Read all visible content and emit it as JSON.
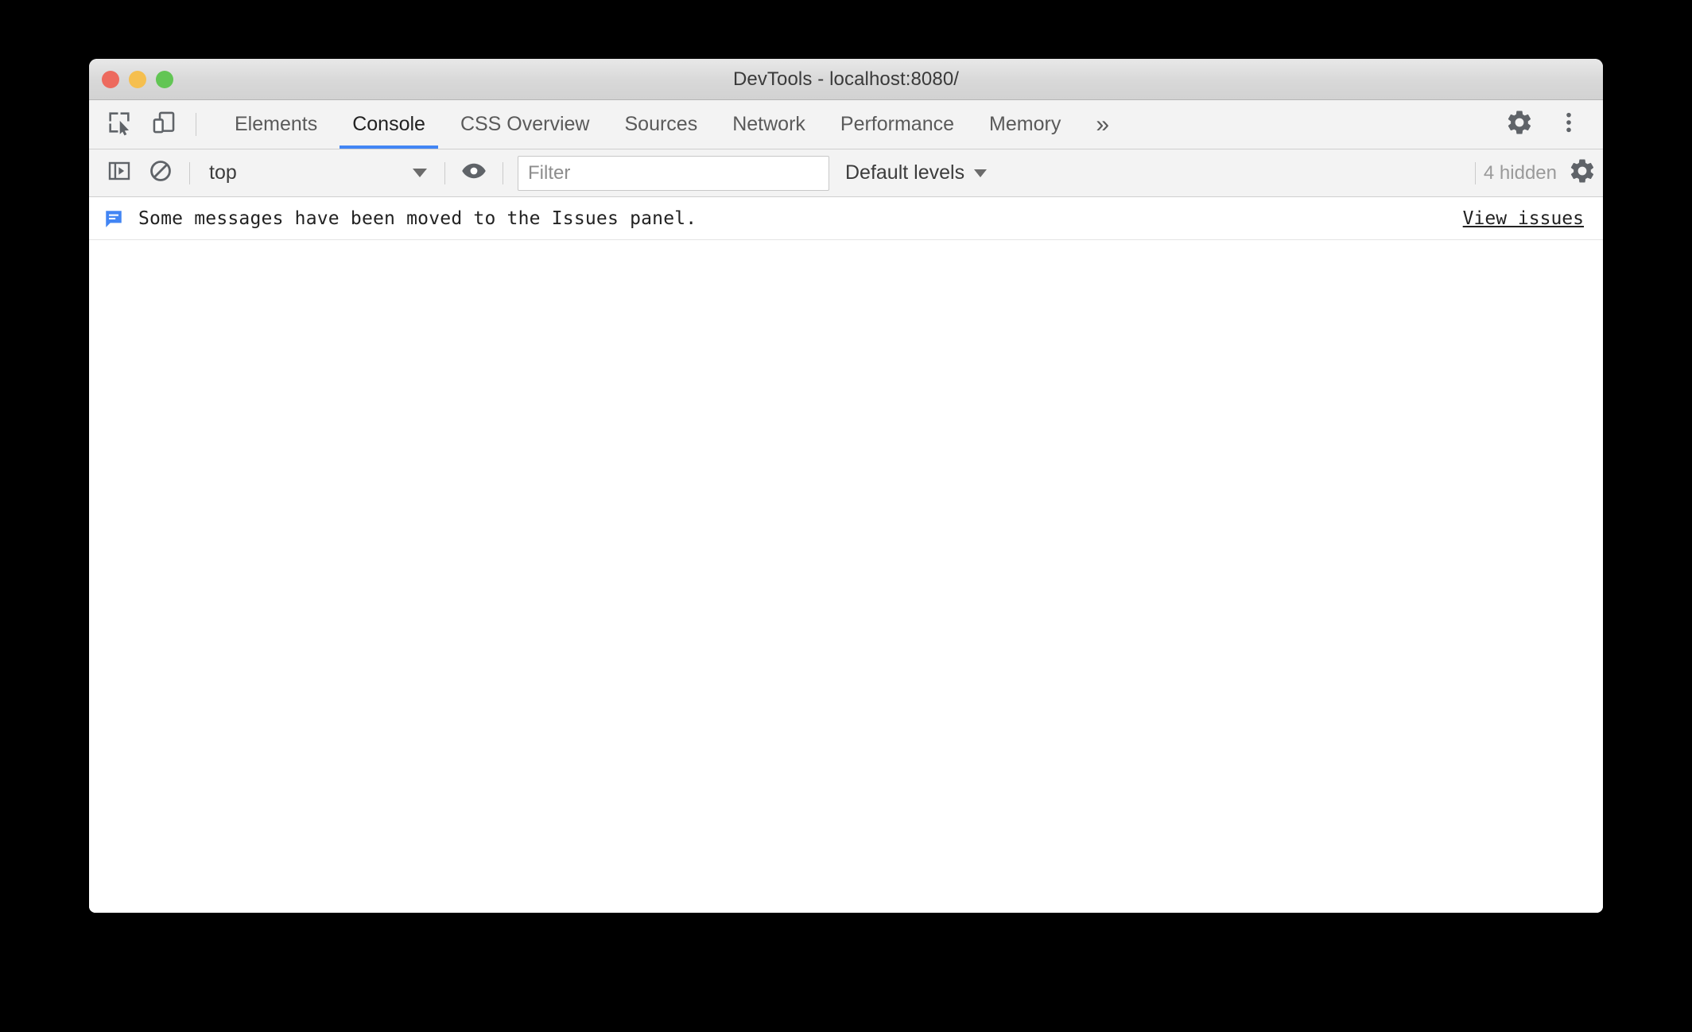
{
  "window": {
    "title": "DevTools - localhost:8080/",
    "traffic_lights": [
      {
        "name": "close",
        "color": "#ed6a5e"
      },
      {
        "name": "minimize",
        "color": "#f5bf4f"
      },
      {
        "name": "maximize",
        "color": "#62c554"
      }
    ]
  },
  "toolbar": {
    "inspect_icon": "inspect-element-icon",
    "device_icon": "device-toolbar-icon",
    "more_tabs_label": "»",
    "settings_icon": "gear-icon",
    "menu_icon": "kebab-menu-icon"
  },
  "tabs": [
    {
      "label": "Elements",
      "active": false
    },
    {
      "label": "Console",
      "active": true
    },
    {
      "label": "CSS Overview",
      "active": false
    },
    {
      "label": "Sources",
      "active": false
    },
    {
      "label": "Network",
      "active": false
    },
    {
      "label": "Performance",
      "active": false
    },
    {
      "label": "Memory",
      "active": false
    }
  ],
  "console_toolbar": {
    "sidebar_toggle_icon": "console-sidebar-toggle-icon",
    "clear_icon": "clear-console-icon",
    "context": {
      "value": "top",
      "caret": "chevron-down-icon"
    },
    "eye_icon": "create-live-expression-icon",
    "filter": {
      "value": "",
      "placeholder": "Filter"
    },
    "levels": {
      "label": "Default levels",
      "caret": "chevron-down-icon"
    },
    "hidden_text": "4 hidden",
    "settings_icon": "console-settings-gear-icon"
  },
  "console_messages": [
    {
      "icon": "issue-message-icon",
      "icon_color": "#4285f4",
      "text": "Some messages have been moved to the Issues panel.",
      "link_label": "View issues"
    }
  ],
  "colors": {
    "accent_blue": "#4285f4",
    "toolbar_bg": "#f3f3f3",
    "titlebar_bg": "#d8d8d8",
    "body_bg": "#ffffff",
    "desktop_bg": "#000000"
  }
}
